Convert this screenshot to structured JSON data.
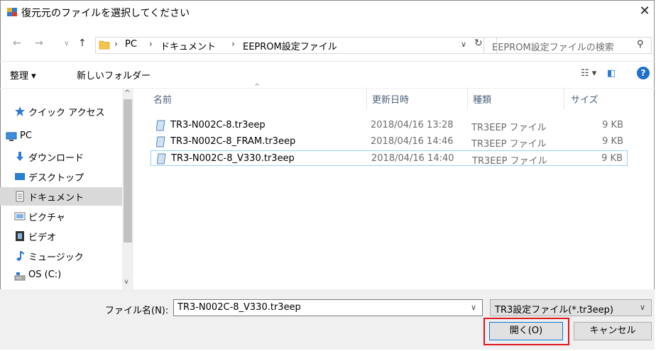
{
  "window": {
    "title": "復元元のファイルを選択してください",
    "close_glyph": "✕"
  },
  "nav": {
    "back_glyph": "←",
    "forward_glyph": "→",
    "recent_glyph": "∨",
    "up_glyph": "↑",
    "breadcrumb": [
      "PC",
      "ドキュメント",
      "EEPROM設定ファイル"
    ],
    "breadcrumb_sep": "›",
    "dropdown_glyph": "∨",
    "refresh_glyph": "↻",
    "search_placeholder": "EEPROM設定ファイルの検索",
    "search_glyph": "⚲"
  },
  "toolbar": {
    "organize": "整理 ▾",
    "new_folder": "新しいフォルダー",
    "view_glyph": "☷ ▾",
    "pane_glyph": "◧",
    "help": "?"
  },
  "sidebar": {
    "items": [
      {
        "label": "クイック アクセス",
        "icon": "star-icon"
      },
      {
        "label": "PC",
        "icon": "pc-icon"
      },
      {
        "label": "ダウンロード",
        "icon": "download-icon"
      },
      {
        "label": "デスクトップ",
        "icon": "desktop-icon"
      },
      {
        "label": "ドキュメント",
        "icon": "document-icon",
        "selected": true
      },
      {
        "label": "ピクチャ",
        "icon": "picture-icon"
      },
      {
        "label": "ビデオ",
        "icon": "video-icon"
      },
      {
        "label": "ミュージック",
        "icon": "music-icon"
      },
      {
        "label": "OS (C:)",
        "icon": "drive-icon"
      }
    ],
    "scroll_up": "^",
    "scroll_down": "v"
  },
  "columns": {
    "name": "名前",
    "date": "更新日時",
    "type": "種類",
    "size": "サイズ",
    "sort_caret": "^"
  },
  "files": [
    {
      "name": "TR3-N002C-8.tr3eep",
      "date": "2018/04/16 13:28",
      "type": "TR3EEP ファイル",
      "size": "9 KB"
    },
    {
      "name": "TR3-N002C-8_FRAM.tr3eep",
      "date": "2018/04/16 14:46",
      "type": "TR3EEP ファイル",
      "size": "9 KB"
    },
    {
      "name": "TR3-N002C-8_V330.tr3eep",
      "date": "2018/04/16 14:40",
      "type": "TR3EEP ファイル",
      "size": "9 KB",
      "selected": true
    }
  ],
  "footer": {
    "filename_label": "ファイル名(N):",
    "filename_value": "TR3-N002C-8_V330.tr3eep",
    "filename_dd": "∨",
    "filetype": "TR3設定ファイル(*.tr3eep)",
    "filetype_dd": "∨",
    "open": "開く(O)",
    "cancel": "キャンセル"
  },
  "colors": {
    "accent": "#0078d7",
    "highlight": "#e0141e",
    "selection": "#d9d9d9"
  }
}
